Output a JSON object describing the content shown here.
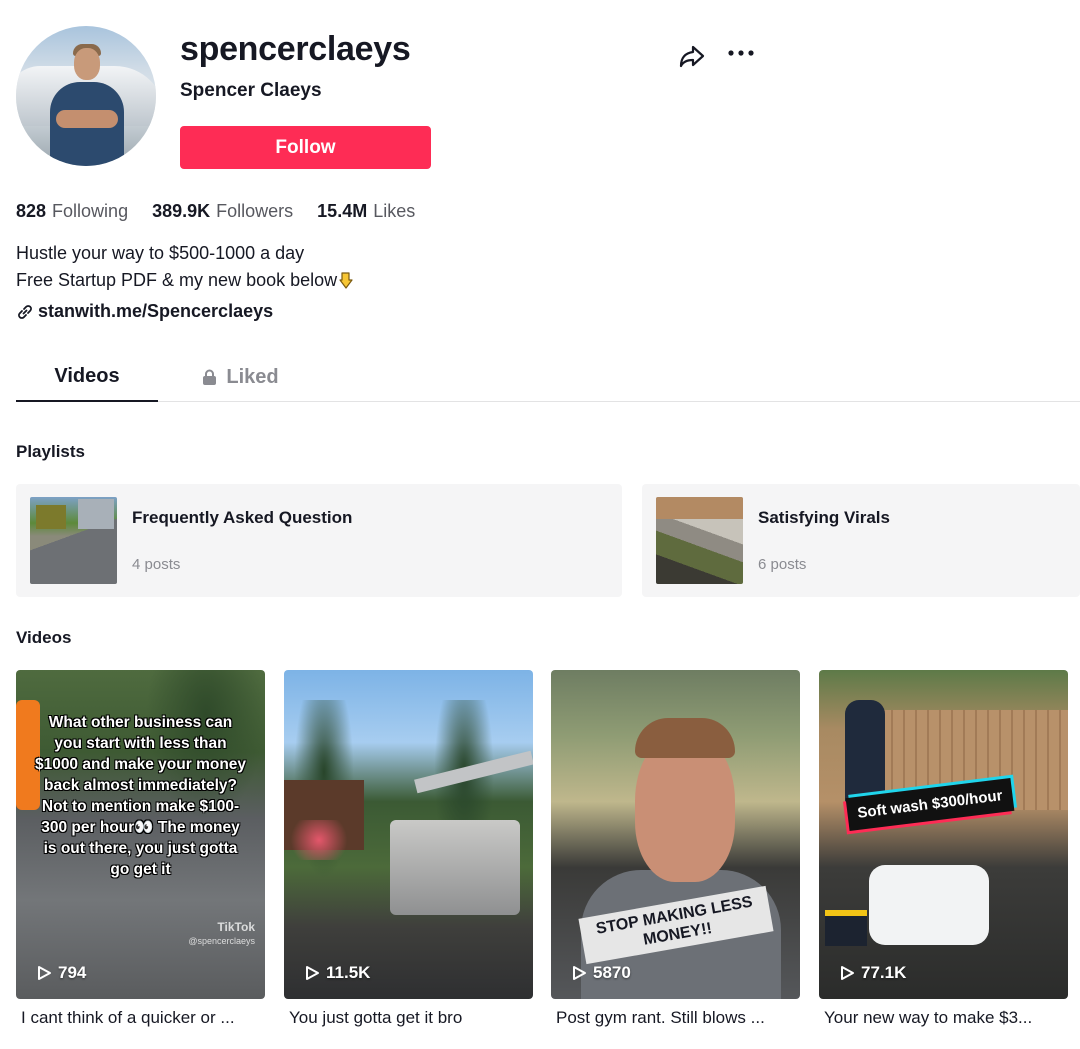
{
  "profile": {
    "username": "spencerclaeys",
    "nickname": "Spencer Claeys",
    "follow_label": "Follow",
    "avatar_icon": "profile-avatar"
  },
  "actions": {
    "share_icon": "share-icon",
    "more_icon": "more-icon"
  },
  "stats": {
    "following_count": "828",
    "following_label": "Following",
    "followers_count": "389.9K",
    "followers_label": "Followers",
    "likes_count": "15.4M",
    "likes_label": "Likes"
  },
  "bio": {
    "line1": "Hustle your way to $500-1000 a day",
    "line2": "Free Startup PDF & my new book below"
  },
  "link": {
    "text": "stanwith.me/Spencerclaeys"
  },
  "tabs": [
    {
      "label": "Videos",
      "active": true
    },
    {
      "label": "Liked",
      "locked": true
    }
  ],
  "playlists_section": {
    "title": "Playlists",
    "items": [
      {
        "name": "Frequently Asked Question",
        "count": "4 posts"
      },
      {
        "name": "Satisfying Virals",
        "count": "6 posts"
      }
    ]
  },
  "videos_section": {
    "title": "Videos",
    "items": [
      {
        "views": "794",
        "caption": "I cant think of a quicker or ...",
        "overlay_text": "What other business can you start with less than $1000 and make your money back almost immediately? Not to mention make $100-300 per hour👀 The money is out there, you just gotta go get it",
        "watermark": "TikTok",
        "watermark_handle": "@spencerclaeys"
      },
      {
        "views": "11.5K",
        "caption": "You just gotta get it bro"
      },
      {
        "views": "5870",
        "caption": "Post gym rant. Still blows ...",
        "sticker_text": "STOP MAKING LESS MONEY!!"
      },
      {
        "views": "77.1K",
        "caption": "Your new way to make $3...",
        "banner_text": "Soft wash $300/hour"
      }
    ]
  },
  "colors": {
    "accent": "#fe2c55",
    "text_primary": "#161823",
    "text_secondary": "#57585f",
    "card_bg": "#f5f5f6"
  }
}
